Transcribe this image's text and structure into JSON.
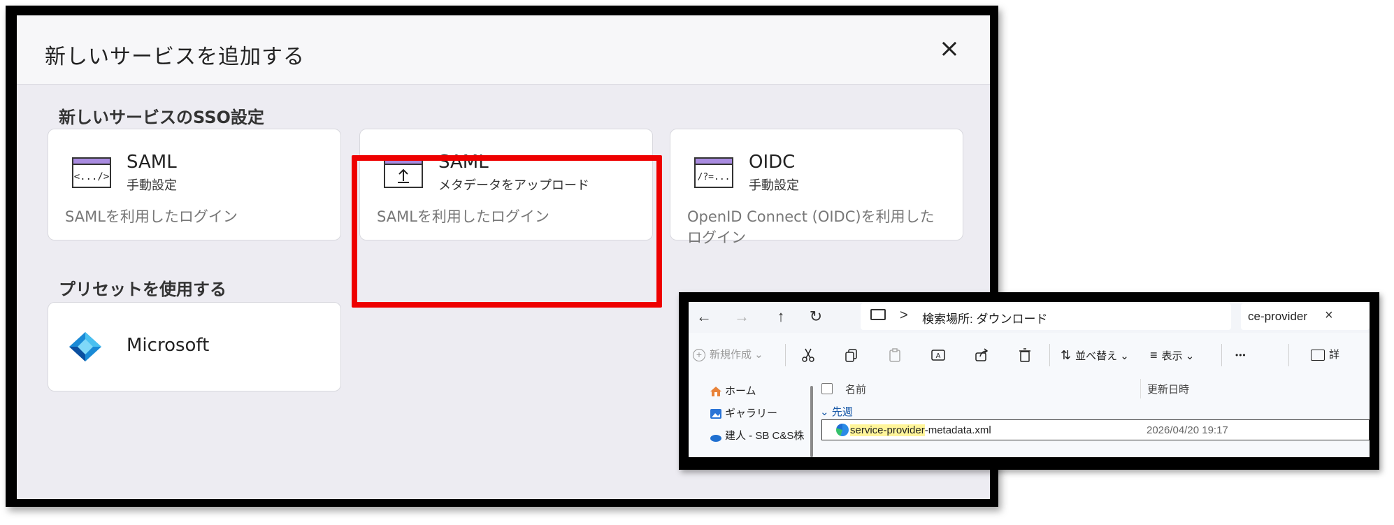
{
  "dialog": {
    "title": "新しいサービスを追加する",
    "close_label": "×",
    "sso_section_title": "新しいサービスのSSO設定",
    "cards": [
      {
        "title": "SAML",
        "subtitle": "手動設定",
        "description": "SAMLを利用したログイン",
        "icon_text": "<.../>",
        "icon": "code-window-icon"
      },
      {
        "title": "SAML",
        "subtitle": "メタデータをアップロード",
        "description": "SAMLを利用したログイン",
        "icon": "upload-window-icon"
      },
      {
        "title": "OIDC",
        "subtitle": "手動設定",
        "description_line1": "OpenID Connect (OIDC)を利用した",
        "description_line2": "ログイン",
        "icon_text": "/?=...",
        "icon": "query-window-icon"
      }
    ],
    "preset_section_title": "プリセットを使用する",
    "presets": [
      {
        "title": "Microsoft",
        "icon": "azure-logo-icon"
      }
    ],
    "highlight_color": "#ee0000",
    "accent_color": "#a98be0"
  },
  "explorer": {
    "address": {
      "separator": ">",
      "path": "検索場所: ダウンロード"
    },
    "search": {
      "query": "ce-provider",
      "clear": "×"
    },
    "toolbar": {
      "new_label": "新規作成",
      "sort_label": "並べ替え",
      "view_label": "表示",
      "more_label": "•••",
      "details_label": "詳"
    },
    "nav_items": [
      {
        "label": "ホーム",
        "icon": "home-icon"
      },
      {
        "label": "ギャラリー",
        "icon": "gallery-icon"
      },
      {
        "label": "建人 - SB C&S株",
        "icon": "cloud-icon"
      }
    ],
    "columns": {
      "name": "名前",
      "date": "更新日時"
    },
    "group_label": "先週",
    "file": {
      "name_highlight": "service-provider",
      "name_rest": "-metadata.xml",
      "date": "2026/04/20 19:17",
      "icon": "edge-icon"
    }
  }
}
